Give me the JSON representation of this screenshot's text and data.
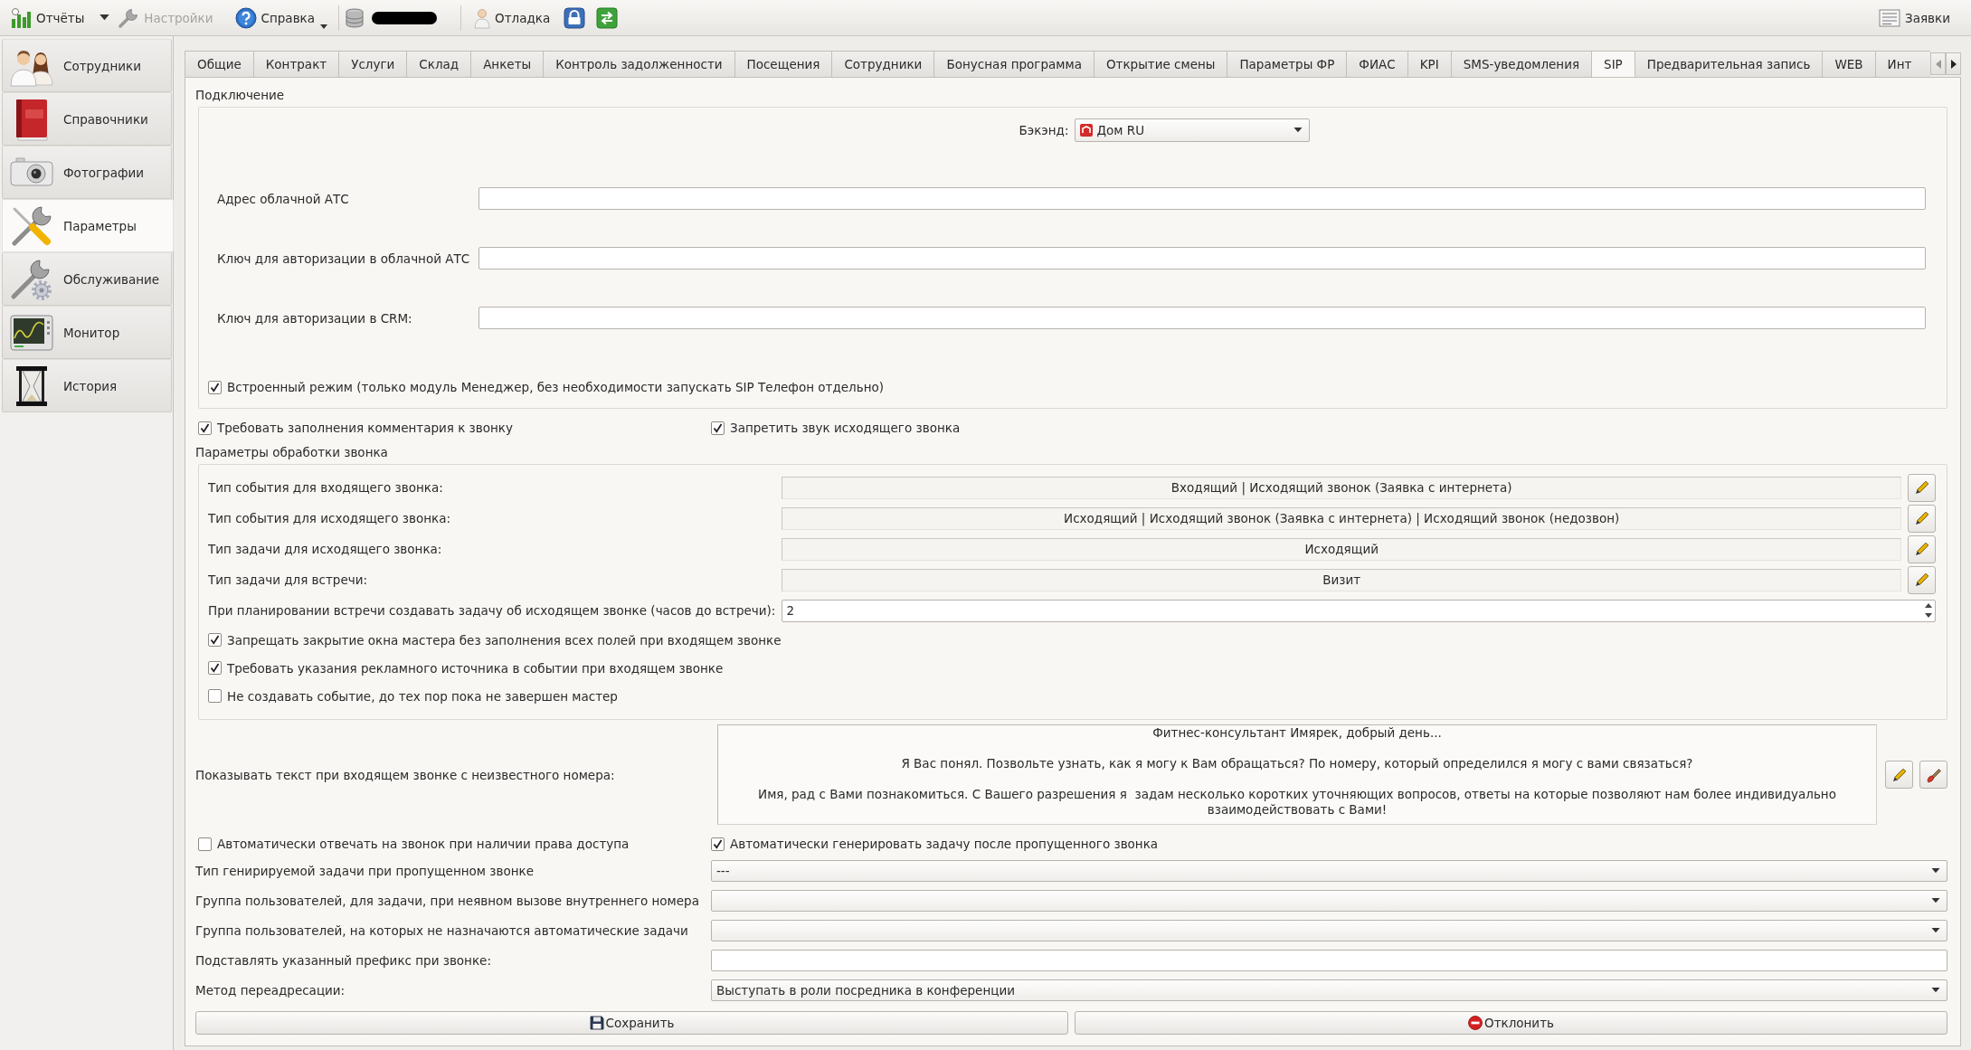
{
  "toolbar": {
    "reports_button": {
      "label": "Отчёты",
      "disabled": false
    },
    "settings_button": {
      "label": "Настройки",
      "disabled": true
    },
    "help_button": {
      "label": "Справка",
      "disabled": false
    },
    "debug_button": {
      "label": "Отладка",
      "disabled": false
    },
    "requests_button": {
      "label": "Заявки",
      "disabled": false
    }
  },
  "sidebar": {
    "items": [
      {
        "label": "Сотрудники",
        "selected": false
      },
      {
        "label": "Справочники",
        "selected": false
      },
      {
        "label": "Фотографии",
        "selected": false
      },
      {
        "label": "Параметры",
        "selected": true
      },
      {
        "label": "Обслуживание",
        "selected": false
      },
      {
        "label": "Монитор",
        "selected": false
      },
      {
        "label": "История",
        "selected": false
      }
    ]
  },
  "tabs": [
    {
      "label": "Общие",
      "selected": false
    },
    {
      "label": "Контракт",
      "selected": false
    },
    {
      "label": "Услуги",
      "selected": false
    },
    {
      "label": "Склад",
      "selected": false
    },
    {
      "label": "Анкеты",
      "selected": false
    },
    {
      "label": "Контроль задолженности",
      "selected": false
    },
    {
      "label": "Посещения",
      "selected": false
    },
    {
      "label": "Сотрудники",
      "selected": false
    },
    {
      "label": "Бонусная программа",
      "selected": false
    },
    {
      "label": "Открытие смены",
      "selected": false
    },
    {
      "label": "Параметры ФР",
      "selected": false
    },
    {
      "label": "ФИАС",
      "selected": false
    },
    {
      "label": "KPI",
      "selected": false
    },
    {
      "label": "SMS-уведомления",
      "selected": false
    },
    {
      "label": "SIP",
      "selected": true
    },
    {
      "label": "Предварительная запись",
      "selected": false
    },
    {
      "label": "WEB",
      "selected": false
    },
    {
      "label": "Инт",
      "selected": false
    }
  ],
  "connection": {
    "title": "Подключение",
    "backend": {
      "label": "Бэкэнд:",
      "value": "Дом RU"
    },
    "fields": [
      {
        "label": "Адрес облачной АТС"
      },
      {
        "label": "Ключ для авторизации в облачной АТС"
      },
      {
        "label": "Ключ для авторизации в CRM:"
      }
    ],
    "embedded_mode": {
      "label": "Встроенный режим (только модуль Менеджер, без необходимости запускать SIP Телефон отдельно)",
      "checked": true
    }
  },
  "call_options": [
    {
      "label": "Требовать заполнения комментария к звонку",
      "checked": true
    },
    {
      "label": "Запретить звук исходящего звонка",
      "checked": true
    }
  ],
  "call_processing": {
    "title": "Параметры обработки звонка",
    "types": [
      {
        "label": "Тип события для входящего звонка:",
        "value": "Входящий | Исходящий звонок (Заявка с интернета)"
      },
      {
        "label": "Тип события для исходящего звонка:",
        "value": "Исходящий | Исходящий звонок (Заявка с интернета) | Исходящий звонок (недозвон)"
      },
      {
        "label": "Тип задачи для исходящего звонка:",
        "value": "Исходящий"
      },
      {
        "label": "Тип задачи для встречи:",
        "value": "Визит"
      }
    ],
    "hours_before_meeting": {
      "label": "При планировании встречи создавать задачу об исходящем звонке (часов до встречи):",
      "value": "2"
    },
    "checkboxes": [
      {
        "label": "Запрещать закрытие окна мастера без заполнения всех полей при входящем звонке",
        "checked": true
      },
      {
        "label": "Требовать указания рекламного источника в событии при входящем звонке",
        "checked": true
      },
      {
        "label": "Не создавать событие, до тех пор пока не завершен мастер",
        "checked": false
      }
    ]
  },
  "unknown_caller_text": {
    "label": "Показывать текст при входящем звонке с неизвестного номера:",
    "paragraphs": [
      "Фитнес-консультант Имярек, добрый день...",
      "Я Вас понял. Позвольте узнать, как я могу к Вам обращаться? По номеру, который определился я могу с вами связаться?",
      "Имя, рад с Вами познакомиться. С Вашего разрешения я  задам несколько коротких уточняющих вопросов, ответы на которые позволяют нам более индивидуально взаимодействовать с Вами!"
    ]
  },
  "auto_options": [
    {
      "label": "Автоматически отвечать на звонок при наличии права доступа",
      "checked": false
    },
    {
      "label": "Автоматически генерировать задачу после пропущенного звонка",
      "checked": true
    }
  ],
  "missed_call_settings": [
    {
      "kind": "combo",
      "label": "Тип генирируемой задачи при пропущенном звонке",
      "value": "---"
    },
    {
      "kind": "combo",
      "label": "Группа пользователей, для задачи, при неявном вызове внутреннего номера"
    },
    {
      "kind": "combo",
      "label": "Группа пользователей, на которых не назначаются автоматические задачи"
    },
    {
      "kind": "input",
      "label": "Подставлять указанный префикс при звонке:"
    },
    {
      "kind": "combo",
      "label": "Метод переадресации:",
      "value": "Выступать в роли посредника в конференции"
    }
  ],
  "buttons": [
    {
      "kind": "save",
      "label": "Сохранить"
    },
    {
      "kind": "reject",
      "label": "Отклонить"
    }
  ]
}
